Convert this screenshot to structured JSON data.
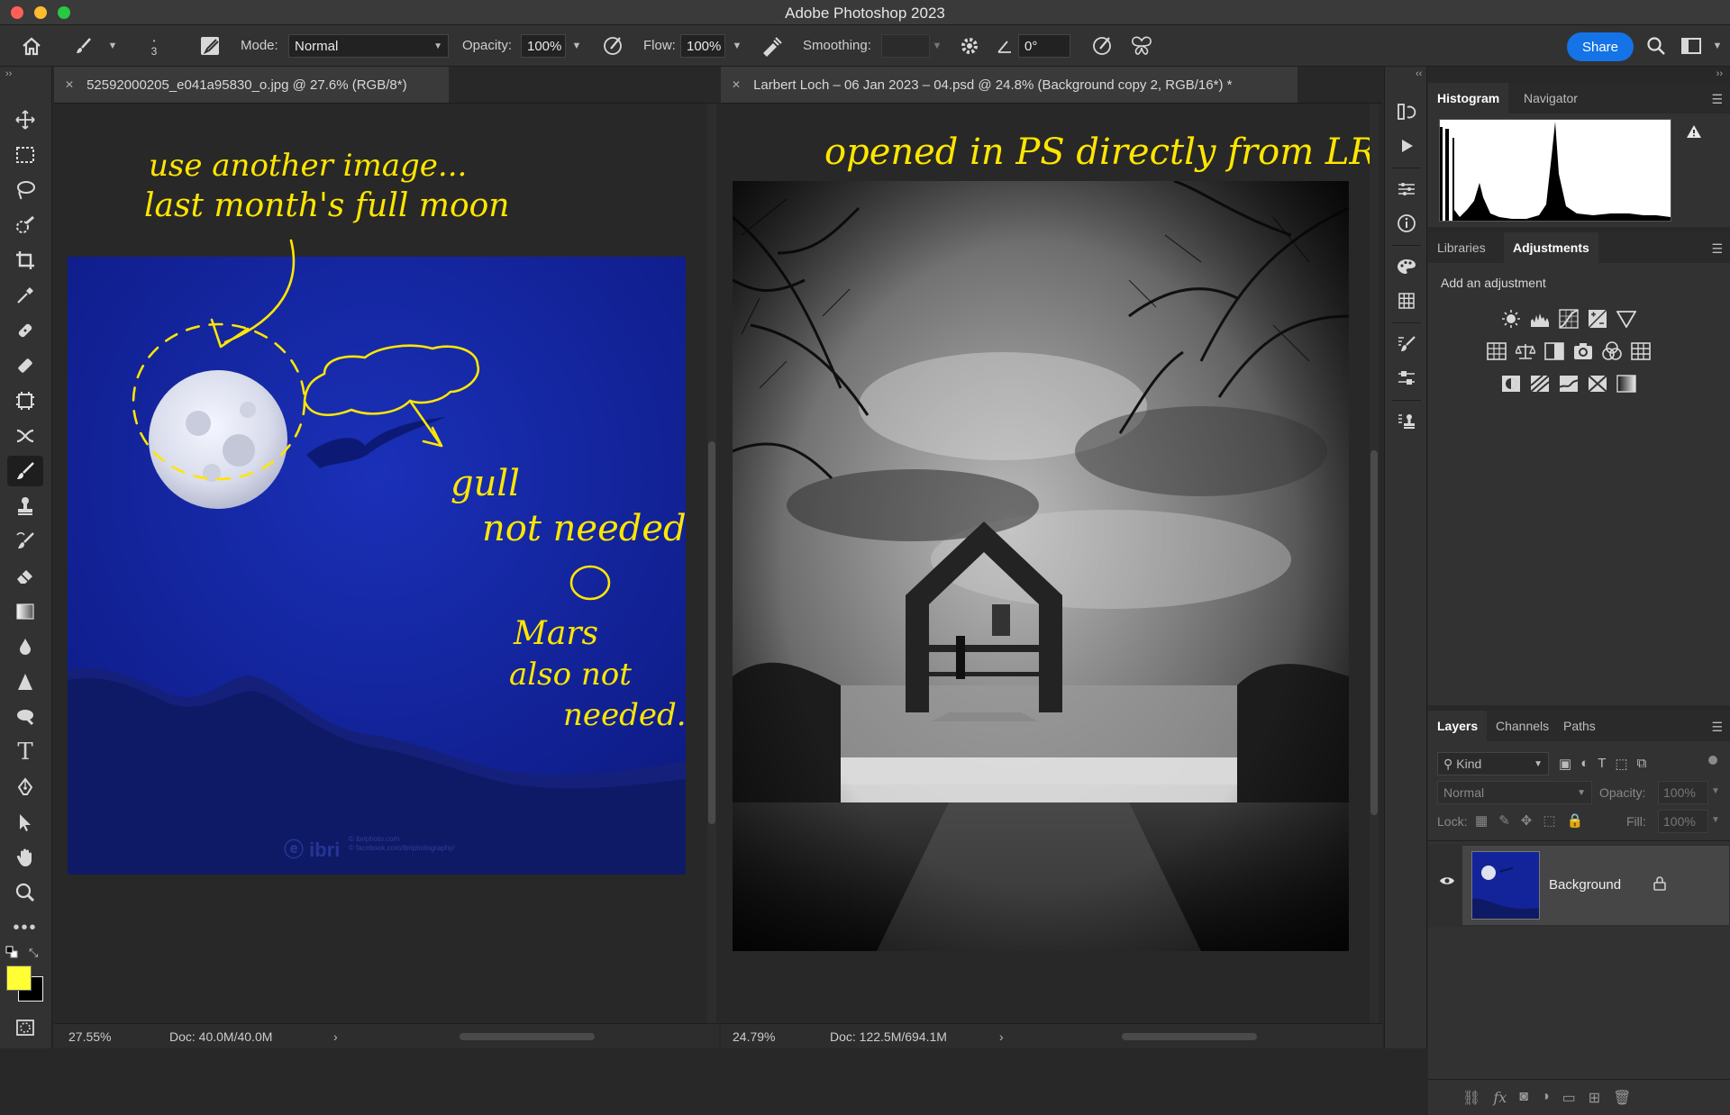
{
  "window": {
    "title": "Adobe Photoshop 2023"
  },
  "options_bar": {
    "brush_size": "3",
    "mode_label": "Mode:",
    "mode_value": "Normal",
    "opacity_label": "Opacity:",
    "opacity_value": "100%",
    "flow_label": "Flow:",
    "flow_value": "100%",
    "smoothing_label": "Smoothing:",
    "smoothing_value": "",
    "angle_value": "0°",
    "share_label": "Share"
  },
  "documents": [
    {
      "tab_title": "52592000205_e041a95830_o.jpg @ 27.6% (RGB/8*)",
      "zoom": "27.55%",
      "doc_size": "Doc: 40.0M/40.0M",
      "annotations": {
        "top": [
          "use another image...",
          "last month's full moon"
        ],
        "gull": [
          "gull",
          "not needed"
        ],
        "mars": [
          "Mars",
          "also not",
          "needed."
        ]
      },
      "watermark": "ibri",
      "watermark_small": "© ibriphoto.com\n© facebook.com/ibriphotography/"
    },
    {
      "tab_title": "Larbert Loch – 06 Jan 2023 – 04.psd @ 24.8% (Background copy 2, RGB/16*) *",
      "zoom": "24.79%",
      "doc_size": "Doc: 122.5M/694.1M",
      "annotation": "opened in PS directly from LR"
    }
  ],
  "panels": {
    "histogram": {
      "tabs": [
        "Histogram",
        "Navigator"
      ],
      "active": "Histogram"
    },
    "adjustments": {
      "tabs": [
        "Libraries",
        "Adjustments"
      ],
      "active": "Adjustments",
      "heading": "Add an adjustment"
    },
    "layers": {
      "tabs": [
        "Layers",
        "Channels",
        "Paths"
      ],
      "active": "Layers",
      "filter_label": "Kind",
      "blend_mode": "Normal",
      "opacity_label": "Opacity:",
      "opacity_value": "100%",
      "lock_label": "Lock:",
      "fill_label": "Fill:",
      "fill_value": "100%",
      "items": [
        {
          "name": "Background",
          "visible": true,
          "locked": true
        }
      ]
    }
  },
  "colors": {
    "foreground": "#ffff33",
    "background": "#000000",
    "accent": "#1473e6",
    "annotation": "#ffe600"
  }
}
